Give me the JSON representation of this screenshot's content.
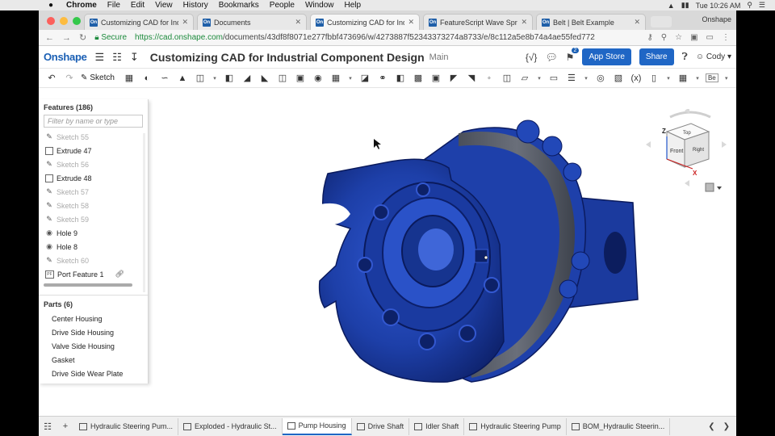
{
  "menubar": {
    "apple": "",
    "items": [
      "Chrome",
      "File",
      "Edit",
      "View",
      "History",
      "Bookmarks",
      "People",
      "Window",
      "Help"
    ],
    "clock": "Tue 10:26 AM"
  },
  "browser": {
    "tabs": [
      {
        "label": "Customizing CAD for Industri",
        "active": false
      },
      {
        "label": "Documents",
        "active": false
      },
      {
        "label": "Customizing CAD for Industri",
        "active": true
      },
      {
        "label": "FeatureScript Wave Spring | V",
        "active": false
      },
      {
        "label": "Belt | Belt Example",
        "active": false
      }
    ],
    "favicon": "On",
    "profile": "Onshape",
    "secure_label": "Secure",
    "url_host": "https://cad.onshape.com",
    "url_path": "/documents/43df8f8071e277fbbf473696/w/4273887f52343373274a8733/e/8c112a5e8b74a4ae55fed772"
  },
  "header": {
    "logo": "Onshape",
    "title": "Customizing CAD for Industrial Component Design",
    "branch": "Main",
    "notification_count": "2",
    "app_store": "App Store",
    "share": "Share",
    "user": "Cody"
  },
  "toolbar": {
    "sketch_label": "Sketch",
    "variable_label": "(x)",
    "be_label": "Be"
  },
  "features": {
    "heading": "Features (186)",
    "filter_placeholder": "Filter by name or type",
    "items": [
      {
        "label": "Sketch 55",
        "type": "sketch",
        "dim": true
      },
      {
        "label": "Extrude 47",
        "type": "extrude",
        "dim": false
      },
      {
        "label": "Sketch 56",
        "type": "sketch",
        "dim": true
      },
      {
        "label": "Extrude 48",
        "type": "extrude",
        "dim": false
      },
      {
        "label": "Sketch 57",
        "type": "sketch",
        "dim": true
      },
      {
        "label": "Sketch 58",
        "type": "sketch",
        "dim": true
      },
      {
        "label": "Sketch 59",
        "type": "sketch",
        "dim": true
      },
      {
        "label": "Hole 9",
        "type": "hole",
        "dim": false
      },
      {
        "label": "Hole 8",
        "type": "hole",
        "dim": false
      },
      {
        "label": "Sketch 60",
        "type": "sketch",
        "dim": true
      },
      {
        "label": "Port Feature 1",
        "type": "custom",
        "dim": false
      }
    ],
    "custom_badge": "PF"
  },
  "parts": {
    "heading": "Parts (6)",
    "items": [
      "Center Housing",
      "Drive Side Housing",
      "Valve Side Housing",
      "Gasket",
      "Drive Side Wear Plate"
    ]
  },
  "view_cube": {
    "top": "Top",
    "front": "Front",
    "right": "Right",
    "axis_z": "Z",
    "axis_x": "X"
  },
  "bottom_tabs": [
    {
      "label": "Hydraulic Steering Pum...",
      "active": false
    },
    {
      "label": "Exploded - Hydraulic St...",
      "active": false
    },
    {
      "label": "Pump Housing",
      "active": true
    },
    {
      "label": "Drive Shaft",
      "active": false
    },
    {
      "label": "Idler Shaft",
      "active": false
    },
    {
      "label": "Hydraulic Steering Pump",
      "active": false
    },
    {
      "label": "BOM_Hydraulic Steerin...",
      "active": false
    }
  ],
  "colors": {
    "brand": "#1a5fb4",
    "part_blue": "#1d3fa8",
    "gasket": "#5a5f6a"
  }
}
